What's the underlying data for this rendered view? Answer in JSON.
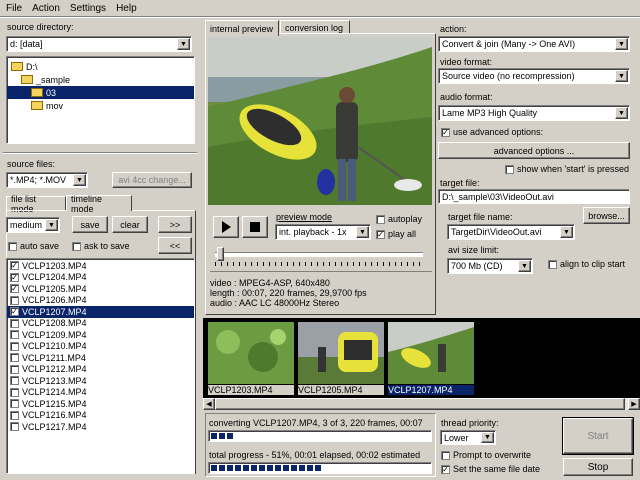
{
  "menu": [
    "File",
    "Action",
    "Settings",
    "Help"
  ],
  "source_directory": {
    "label": "source directory:",
    "combo_value": "d: [data]",
    "tree": [
      {
        "label": "D:\\",
        "indent": 0,
        "selected": false
      },
      {
        "label": "_sample",
        "indent": 1,
        "selected": false
      },
      {
        "label": "03",
        "indent": 2,
        "selected": true
      },
      {
        "label": "mov",
        "indent": 2,
        "selected": false
      }
    ]
  },
  "source_files": {
    "label": "source files:",
    "filter": "*.MP4; *.MOV",
    "fourcc_button": "avi 4cc change..."
  },
  "mode_tabs": [
    "file list mode",
    "timeline mode"
  ],
  "file_controls": {
    "quality": "medium",
    "save": "save",
    "clear": "clear",
    "forward": ">>",
    "back": "<<",
    "auto_save": "auto save",
    "ask_to_save": "ask to save"
  },
  "files": [
    {
      "name": "VCLP1203.MP4",
      "checked": true,
      "selected": false
    },
    {
      "name": "VCLP1204.MP4",
      "checked": true,
      "selected": false
    },
    {
      "name": "VCLP1205.MP4",
      "checked": true,
      "selected": false
    },
    {
      "name": "VCLP1206.MP4",
      "checked": false,
      "selected": false
    },
    {
      "name": "VCLP1207.MP4",
      "checked": true,
      "selected": true
    },
    {
      "name": "VCLP1208.MP4",
      "checked": false,
      "selected": false
    },
    {
      "name": "VCLP1209.MP4",
      "checked": false,
      "selected": false
    },
    {
      "name": "VCLP1210.MP4",
      "checked": false,
      "selected": false
    },
    {
      "name": "VCLP1211.MP4",
      "checked": false,
      "selected": false
    },
    {
      "name": "VCLP1212.MP4",
      "checked": false,
      "selected": false
    },
    {
      "name": "VCLP1213.MP4",
      "checked": false,
      "selected": false
    },
    {
      "name": "VCLP1214.MP4",
      "checked": false,
      "selected": false
    },
    {
      "name": "VCLP1215.MP4",
      "checked": false,
      "selected": false
    },
    {
      "name": "VCLP1216.MP4",
      "checked": false,
      "selected": false
    },
    {
      "name": "VCLP1217.MP4",
      "checked": false,
      "selected": false
    }
  ],
  "preview_tabs": [
    "internal preview",
    "conversion log"
  ],
  "playback": {
    "preview_mode_label": "preview mode",
    "preview_mode_value": "int. playback - 1x",
    "autoplay": "autoplay",
    "play_all": "play all",
    "autoplay_checked": false,
    "play_all_checked": true
  },
  "file_info": {
    "video": "video : MPEG4-ASP, 640x480",
    "length": "length : 00:07, 220 frames, 29,9700 fps",
    "audio": "audio : AAC LC 48000Hz Stereo"
  },
  "thumbnails": [
    "VCLP1203.MP4",
    "VCLP1205.MP4",
    "VCLP1207.MP4"
  ],
  "status": {
    "converting": "converting VCLP1207.MP4, 3 of 3, 220 frames, 00:07",
    "total": "total progress - 51%, 00:01 elapsed, 00:02 estimated",
    "current_progress": 0.1,
    "total_progress": 0.51
  },
  "right_panel": {
    "action_label": "action:",
    "action_value": "Convert & join (Many -> One AVI)",
    "video_format_label": "video format:",
    "video_format_value": "Source video (no recompression)",
    "audio_format_label": "audio format:",
    "audio_format_value": "Lame MP3 High Quality",
    "use_advanced": "use advanced options:",
    "advanced_button": "advanced options ...",
    "show_when_start": "show when 'start' is pressed",
    "target_file_label": "target file:",
    "target_file_value": "D:\\_sample\\03\\VideoOut.avi",
    "target_file_name_label": "target file name:",
    "target_file_name_value": "TargetDir\\VideoOut.avi",
    "browse": "browse...",
    "avi_size_label": "avi size limit:",
    "avi_size_value": "700 Mb (CD)",
    "align_to_clip": "align to clip start",
    "thread_priority_label": "thread priority:",
    "thread_priority_value": "Lower",
    "prompt_overwrite": "Prompt to overwrite",
    "same_file_date": "Set the same file date",
    "start": "Start",
    "stop": "Stop"
  }
}
